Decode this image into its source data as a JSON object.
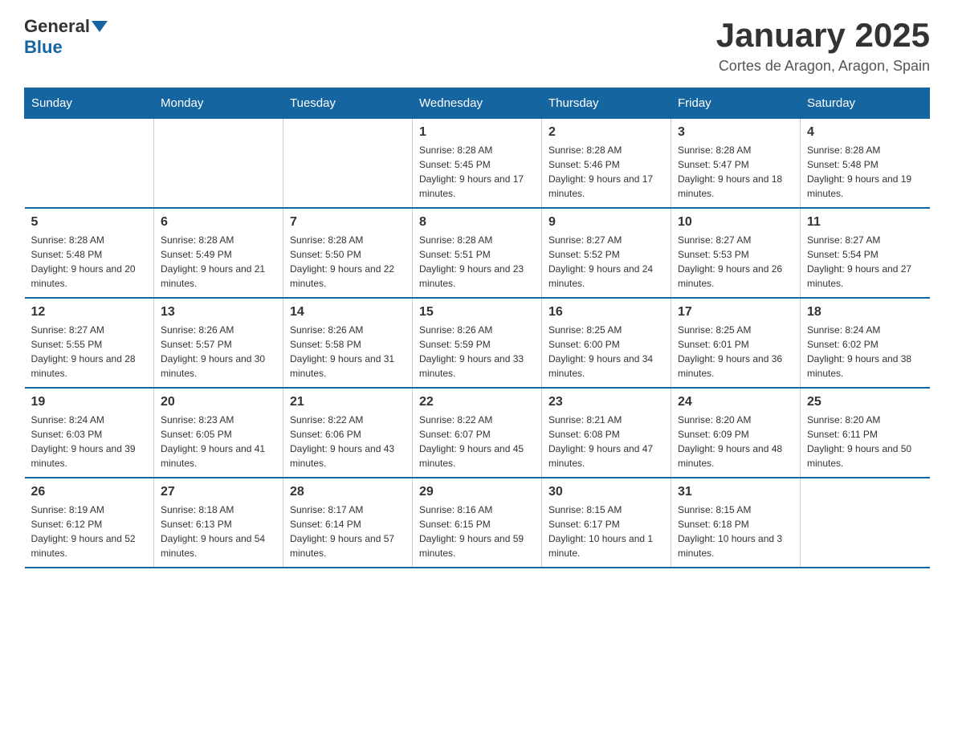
{
  "header": {
    "logo": {
      "general": "General",
      "blue": "Blue"
    },
    "title": "January 2025",
    "subtitle": "Cortes de Aragon, Aragon, Spain"
  },
  "calendar": {
    "days_of_week": [
      "Sunday",
      "Monday",
      "Tuesday",
      "Wednesday",
      "Thursday",
      "Friday",
      "Saturday"
    ],
    "weeks": [
      [
        {
          "day": "",
          "info": ""
        },
        {
          "day": "",
          "info": ""
        },
        {
          "day": "",
          "info": ""
        },
        {
          "day": "1",
          "info": "Sunrise: 8:28 AM\nSunset: 5:45 PM\nDaylight: 9 hours and 17 minutes."
        },
        {
          "day": "2",
          "info": "Sunrise: 8:28 AM\nSunset: 5:46 PM\nDaylight: 9 hours and 17 minutes."
        },
        {
          "day": "3",
          "info": "Sunrise: 8:28 AM\nSunset: 5:47 PM\nDaylight: 9 hours and 18 minutes."
        },
        {
          "day": "4",
          "info": "Sunrise: 8:28 AM\nSunset: 5:48 PM\nDaylight: 9 hours and 19 minutes."
        }
      ],
      [
        {
          "day": "5",
          "info": "Sunrise: 8:28 AM\nSunset: 5:48 PM\nDaylight: 9 hours and 20 minutes."
        },
        {
          "day": "6",
          "info": "Sunrise: 8:28 AM\nSunset: 5:49 PM\nDaylight: 9 hours and 21 minutes."
        },
        {
          "day": "7",
          "info": "Sunrise: 8:28 AM\nSunset: 5:50 PM\nDaylight: 9 hours and 22 minutes."
        },
        {
          "day": "8",
          "info": "Sunrise: 8:28 AM\nSunset: 5:51 PM\nDaylight: 9 hours and 23 minutes."
        },
        {
          "day": "9",
          "info": "Sunrise: 8:27 AM\nSunset: 5:52 PM\nDaylight: 9 hours and 24 minutes."
        },
        {
          "day": "10",
          "info": "Sunrise: 8:27 AM\nSunset: 5:53 PM\nDaylight: 9 hours and 26 minutes."
        },
        {
          "day": "11",
          "info": "Sunrise: 8:27 AM\nSunset: 5:54 PM\nDaylight: 9 hours and 27 minutes."
        }
      ],
      [
        {
          "day": "12",
          "info": "Sunrise: 8:27 AM\nSunset: 5:55 PM\nDaylight: 9 hours and 28 minutes."
        },
        {
          "day": "13",
          "info": "Sunrise: 8:26 AM\nSunset: 5:57 PM\nDaylight: 9 hours and 30 minutes."
        },
        {
          "day": "14",
          "info": "Sunrise: 8:26 AM\nSunset: 5:58 PM\nDaylight: 9 hours and 31 minutes."
        },
        {
          "day": "15",
          "info": "Sunrise: 8:26 AM\nSunset: 5:59 PM\nDaylight: 9 hours and 33 minutes."
        },
        {
          "day": "16",
          "info": "Sunrise: 8:25 AM\nSunset: 6:00 PM\nDaylight: 9 hours and 34 minutes."
        },
        {
          "day": "17",
          "info": "Sunrise: 8:25 AM\nSunset: 6:01 PM\nDaylight: 9 hours and 36 minutes."
        },
        {
          "day": "18",
          "info": "Sunrise: 8:24 AM\nSunset: 6:02 PM\nDaylight: 9 hours and 38 minutes."
        }
      ],
      [
        {
          "day": "19",
          "info": "Sunrise: 8:24 AM\nSunset: 6:03 PM\nDaylight: 9 hours and 39 minutes."
        },
        {
          "day": "20",
          "info": "Sunrise: 8:23 AM\nSunset: 6:05 PM\nDaylight: 9 hours and 41 minutes."
        },
        {
          "day": "21",
          "info": "Sunrise: 8:22 AM\nSunset: 6:06 PM\nDaylight: 9 hours and 43 minutes."
        },
        {
          "day": "22",
          "info": "Sunrise: 8:22 AM\nSunset: 6:07 PM\nDaylight: 9 hours and 45 minutes."
        },
        {
          "day": "23",
          "info": "Sunrise: 8:21 AM\nSunset: 6:08 PM\nDaylight: 9 hours and 47 minutes."
        },
        {
          "day": "24",
          "info": "Sunrise: 8:20 AM\nSunset: 6:09 PM\nDaylight: 9 hours and 48 minutes."
        },
        {
          "day": "25",
          "info": "Sunrise: 8:20 AM\nSunset: 6:11 PM\nDaylight: 9 hours and 50 minutes."
        }
      ],
      [
        {
          "day": "26",
          "info": "Sunrise: 8:19 AM\nSunset: 6:12 PM\nDaylight: 9 hours and 52 minutes."
        },
        {
          "day": "27",
          "info": "Sunrise: 8:18 AM\nSunset: 6:13 PM\nDaylight: 9 hours and 54 minutes."
        },
        {
          "day": "28",
          "info": "Sunrise: 8:17 AM\nSunset: 6:14 PM\nDaylight: 9 hours and 57 minutes."
        },
        {
          "day": "29",
          "info": "Sunrise: 8:16 AM\nSunset: 6:15 PM\nDaylight: 9 hours and 59 minutes."
        },
        {
          "day": "30",
          "info": "Sunrise: 8:15 AM\nSunset: 6:17 PM\nDaylight: 10 hours and 1 minute."
        },
        {
          "day": "31",
          "info": "Sunrise: 8:15 AM\nSunset: 6:18 PM\nDaylight: 10 hours and 3 minutes."
        },
        {
          "day": "",
          "info": ""
        }
      ]
    ]
  }
}
